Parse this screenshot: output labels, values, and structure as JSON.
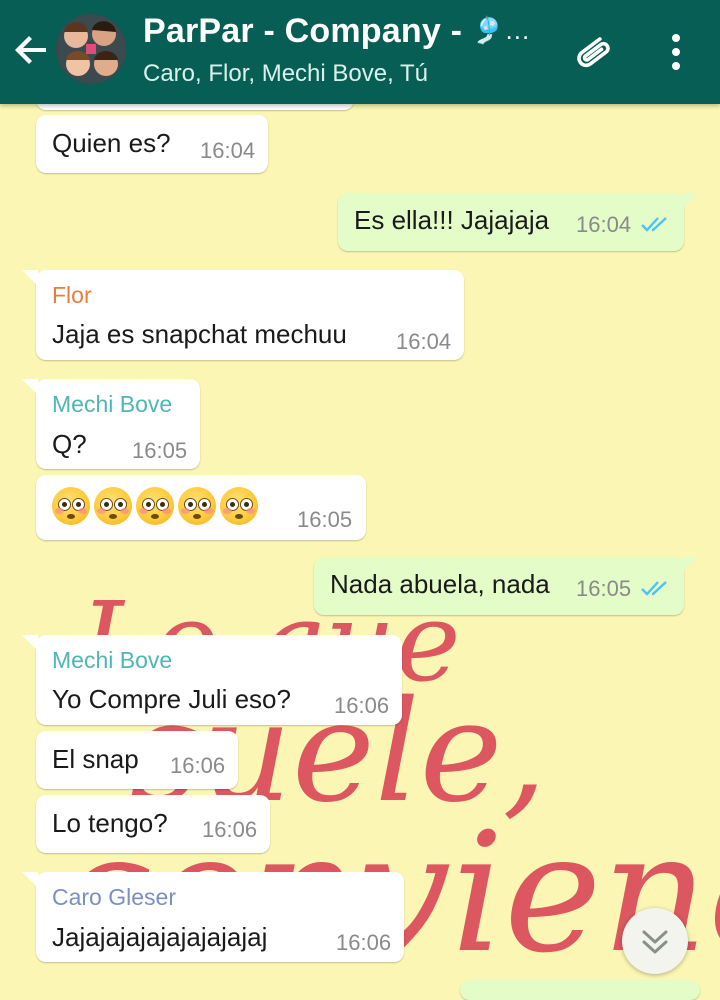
{
  "header": {
    "title": "ParPar - Company - ",
    "title_emoji": "🎐…",
    "subtitle": "Caro, Flor, Mechi Bove, Tú",
    "background": "#075e54"
  },
  "wallpaper": {
    "background": "#fbf6b3",
    "text_lines": [
      "Lo que",
      "suele,",
      "conviene"
    ],
    "text_color": "#d63a4a"
  },
  "messages": [
    {
      "type": "in",
      "text": "Quien es?",
      "time": "16:04"
    },
    {
      "type": "out",
      "text": "Es ella!!! Jajajaja",
      "time": "16:04",
      "status": "read"
    },
    {
      "type": "in",
      "sender": "Flor",
      "sender_color": "#e67e3e",
      "text": "Jaja es snapchat mechuu",
      "time": "16:04"
    },
    {
      "type": "in",
      "sender": "Mechi Bove",
      "sender_color": "#4fb5b5",
      "text": "Q?",
      "time": "16:05"
    },
    {
      "type": "in",
      "emoji": "😳😳😳😳😳",
      "time": "16:05"
    },
    {
      "type": "out",
      "text": "Nada abuela, nada",
      "time": "16:05",
      "status": "read"
    },
    {
      "type": "in",
      "sender": "Mechi Bove",
      "sender_color": "#4fb5b5",
      "text": "Yo Compre Juli eso?",
      "time": "16:06"
    },
    {
      "type": "in",
      "text": "El snap",
      "time": "16:06"
    },
    {
      "type": "in",
      "text": "Lo tengo?",
      "time": "16:06"
    },
    {
      "type": "in",
      "sender": "Caro Gleser",
      "sender_color": "#7c8fc4",
      "text": "Jajajajajajajajajajaj",
      "time": "16:06"
    }
  ],
  "icons": {
    "back": "back-arrow-icon",
    "attach": "paperclip-icon",
    "menu": "more-vert-icon",
    "scroll": "chevron-double-down-icon",
    "read": "double-check-icon"
  }
}
